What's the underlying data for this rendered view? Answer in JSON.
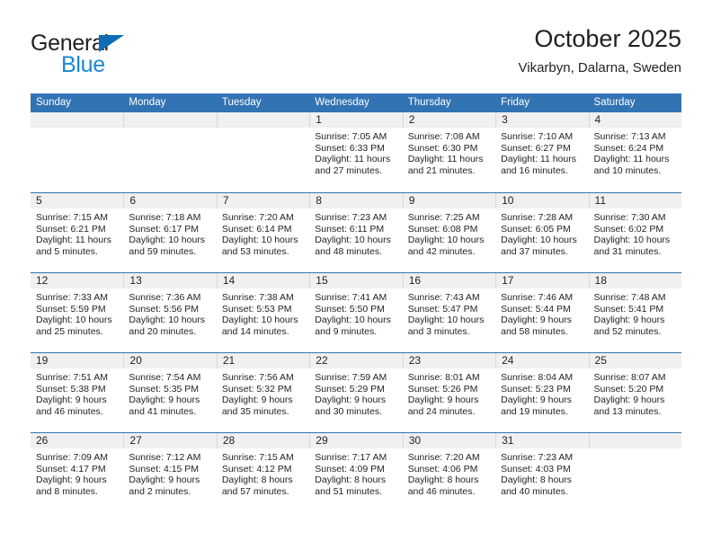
{
  "brand": {
    "name_part1": "General",
    "name_part2": "Blue",
    "triangle_color": "#0f6cb5",
    "blue_text_color": "#1b87d4"
  },
  "header": {
    "title": "October 2025",
    "location": "Vikarbyn, Dalarna, Sweden"
  },
  "theme": {
    "header_blue": "#3273b3",
    "daynum_band": "#f0f0f0",
    "text": "#231f20"
  },
  "weekdays": [
    "Sunday",
    "Monday",
    "Tuesday",
    "Wednesday",
    "Thursday",
    "Friday",
    "Saturday"
  ],
  "weeks": [
    [
      {
        "day": "",
        "lines": []
      },
      {
        "day": "",
        "lines": []
      },
      {
        "day": "",
        "lines": []
      },
      {
        "day": "1",
        "lines": [
          "Sunrise: 7:05 AM",
          "Sunset: 6:33 PM",
          "Daylight: 11 hours",
          "and 27 minutes."
        ]
      },
      {
        "day": "2",
        "lines": [
          "Sunrise: 7:08 AM",
          "Sunset: 6:30 PM",
          "Daylight: 11 hours",
          "and 21 minutes."
        ]
      },
      {
        "day": "3",
        "lines": [
          "Sunrise: 7:10 AM",
          "Sunset: 6:27 PM",
          "Daylight: 11 hours",
          "and 16 minutes."
        ]
      },
      {
        "day": "4",
        "lines": [
          "Sunrise: 7:13 AM",
          "Sunset: 6:24 PM",
          "Daylight: 11 hours",
          "and 10 minutes."
        ]
      }
    ],
    [
      {
        "day": "5",
        "lines": [
          "Sunrise: 7:15 AM",
          "Sunset: 6:21 PM",
          "Daylight: 11 hours",
          "and 5 minutes."
        ]
      },
      {
        "day": "6",
        "lines": [
          "Sunrise: 7:18 AM",
          "Sunset: 6:17 PM",
          "Daylight: 10 hours",
          "and 59 minutes."
        ]
      },
      {
        "day": "7",
        "lines": [
          "Sunrise: 7:20 AM",
          "Sunset: 6:14 PM",
          "Daylight: 10 hours",
          "and 53 minutes."
        ]
      },
      {
        "day": "8",
        "lines": [
          "Sunrise: 7:23 AM",
          "Sunset: 6:11 PM",
          "Daylight: 10 hours",
          "and 48 minutes."
        ]
      },
      {
        "day": "9",
        "lines": [
          "Sunrise: 7:25 AM",
          "Sunset: 6:08 PM",
          "Daylight: 10 hours",
          "and 42 minutes."
        ]
      },
      {
        "day": "10",
        "lines": [
          "Sunrise: 7:28 AM",
          "Sunset: 6:05 PM",
          "Daylight: 10 hours",
          "and 37 minutes."
        ]
      },
      {
        "day": "11",
        "lines": [
          "Sunrise: 7:30 AM",
          "Sunset: 6:02 PM",
          "Daylight: 10 hours",
          "and 31 minutes."
        ]
      }
    ],
    [
      {
        "day": "12",
        "lines": [
          "Sunrise: 7:33 AM",
          "Sunset: 5:59 PM",
          "Daylight: 10 hours",
          "and 25 minutes."
        ]
      },
      {
        "day": "13",
        "lines": [
          "Sunrise: 7:36 AM",
          "Sunset: 5:56 PM",
          "Daylight: 10 hours",
          "and 20 minutes."
        ]
      },
      {
        "day": "14",
        "lines": [
          "Sunrise: 7:38 AM",
          "Sunset: 5:53 PM",
          "Daylight: 10 hours",
          "and 14 minutes."
        ]
      },
      {
        "day": "15",
        "lines": [
          "Sunrise: 7:41 AM",
          "Sunset: 5:50 PM",
          "Daylight: 10 hours",
          "and 9 minutes."
        ]
      },
      {
        "day": "16",
        "lines": [
          "Sunrise: 7:43 AM",
          "Sunset: 5:47 PM",
          "Daylight: 10 hours",
          "and 3 minutes."
        ]
      },
      {
        "day": "17",
        "lines": [
          "Sunrise: 7:46 AM",
          "Sunset: 5:44 PM",
          "Daylight: 9 hours",
          "and 58 minutes."
        ]
      },
      {
        "day": "18",
        "lines": [
          "Sunrise: 7:48 AM",
          "Sunset: 5:41 PM",
          "Daylight: 9 hours",
          "and 52 minutes."
        ]
      }
    ],
    [
      {
        "day": "19",
        "lines": [
          "Sunrise: 7:51 AM",
          "Sunset: 5:38 PM",
          "Daylight: 9 hours",
          "and 46 minutes."
        ]
      },
      {
        "day": "20",
        "lines": [
          "Sunrise: 7:54 AM",
          "Sunset: 5:35 PM",
          "Daylight: 9 hours",
          "and 41 minutes."
        ]
      },
      {
        "day": "21",
        "lines": [
          "Sunrise: 7:56 AM",
          "Sunset: 5:32 PM",
          "Daylight: 9 hours",
          "and 35 minutes."
        ]
      },
      {
        "day": "22",
        "lines": [
          "Sunrise: 7:59 AM",
          "Sunset: 5:29 PM",
          "Daylight: 9 hours",
          "and 30 minutes."
        ]
      },
      {
        "day": "23",
        "lines": [
          "Sunrise: 8:01 AM",
          "Sunset: 5:26 PM",
          "Daylight: 9 hours",
          "and 24 minutes."
        ]
      },
      {
        "day": "24",
        "lines": [
          "Sunrise: 8:04 AM",
          "Sunset: 5:23 PM",
          "Daylight: 9 hours",
          "and 19 minutes."
        ]
      },
      {
        "day": "25",
        "lines": [
          "Sunrise: 8:07 AM",
          "Sunset: 5:20 PM",
          "Daylight: 9 hours",
          "and 13 minutes."
        ]
      }
    ],
    [
      {
        "day": "26",
        "lines": [
          "Sunrise: 7:09 AM",
          "Sunset: 4:17 PM",
          "Daylight: 9 hours",
          "and 8 minutes."
        ]
      },
      {
        "day": "27",
        "lines": [
          "Sunrise: 7:12 AM",
          "Sunset: 4:15 PM",
          "Daylight: 9 hours",
          "and 2 minutes."
        ]
      },
      {
        "day": "28",
        "lines": [
          "Sunrise: 7:15 AM",
          "Sunset: 4:12 PM",
          "Daylight: 8 hours",
          "and 57 minutes."
        ]
      },
      {
        "day": "29",
        "lines": [
          "Sunrise: 7:17 AM",
          "Sunset: 4:09 PM",
          "Daylight: 8 hours",
          "and 51 minutes."
        ]
      },
      {
        "day": "30",
        "lines": [
          "Sunrise: 7:20 AM",
          "Sunset: 4:06 PM",
          "Daylight: 8 hours",
          "and 46 minutes."
        ]
      },
      {
        "day": "31",
        "lines": [
          "Sunrise: 7:23 AM",
          "Sunset: 4:03 PM",
          "Daylight: 8 hours",
          "and 40 minutes."
        ]
      },
      {
        "day": "",
        "lines": []
      }
    ]
  ]
}
